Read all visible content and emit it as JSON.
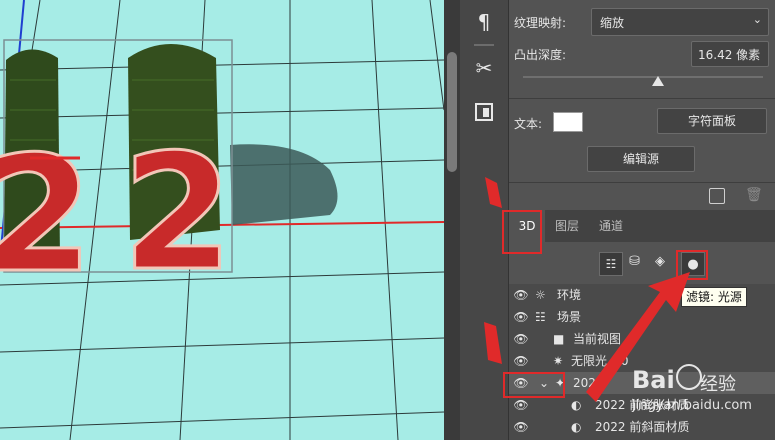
{
  "properties": {
    "texture_label": "纹理映射:",
    "texture_value": "缩放",
    "depth_label": "凸出深度:",
    "depth_value": "16.42 像素",
    "text_label": "文本:",
    "char_panel_button": "字符面板",
    "edit_source_button": "编辑源"
  },
  "tabs": [
    "3D",
    "图层",
    "通道"
  ],
  "tooltip": "滤镜: 光源",
  "layers": [
    {
      "name": "环境",
      "icon": "environment-icon"
    },
    {
      "name": "场景",
      "icon": "scene-icon"
    },
    {
      "name": "当前视图",
      "icon": "camera-icon"
    },
    {
      "name": "无限光 ^0",
      "icon": "infinite-light-icon"
    },
    {
      "name": "2022",
      "icon": "mesh-icon"
    },
    {
      "name": "2022 前膨胀材质",
      "icon": "material-icon"
    },
    {
      "name": "2022 前斜面材质",
      "icon": "material-icon"
    }
  ],
  "watermark": {
    "brand": "Bai",
    "brand_cn": "经验",
    "url": "jingyan.baidu.com"
  },
  "colors": {
    "grid_floor": "#a6ece6",
    "accent_red": "#e02a2a",
    "panel_bg": "#535353"
  }
}
